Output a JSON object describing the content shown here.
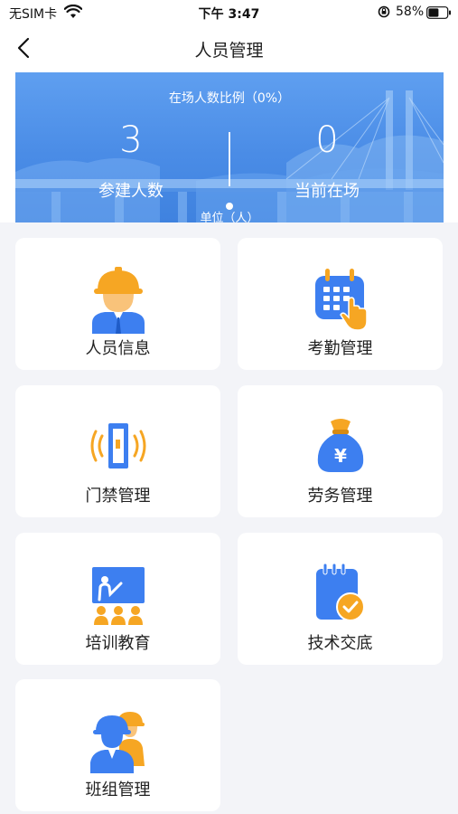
{
  "status_bar": {
    "carrier": "无SIM卡",
    "time": "下午 3:47",
    "battery_percent": "58%",
    "battery_level": 0.58
  },
  "nav": {
    "title": "人员管理",
    "back_icon": "chevron-left-icon"
  },
  "banner": {
    "ratio_text": "在场人数比例（0%）",
    "stats": [
      {
        "value": "3",
        "label": "参建人数"
      },
      {
        "value": "0",
        "label": "当前在场"
      }
    ],
    "unit_text": "单位（人）"
  },
  "menu": [
    {
      "label": "人员信息",
      "icon": "worker-helmet-icon"
    },
    {
      "label": "考勤管理",
      "icon": "calendar-tap-icon"
    },
    {
      "label": "门禁管理",
      "icon": "access-gate-icon"
    },
    {
      "label": "劳务管理",
      "icon": "money-bag-icon"
    },
    {
      "label": "培训教育",
      "icon": "training-board-icon"
    },
    {
      "label": "技术交底",
      "icon": "notepad-check-icon"
    },
    {
      "label": "班组管理",
      "icon": "team-icon"
    }
  ],
  "colors": {
    "accent_blue": "#3d7ff0",
    "accent_orange": "#f6a623",
    "banner_blue": "#4a8ce6",
    "background": "#f3f4f8"
  }
}
